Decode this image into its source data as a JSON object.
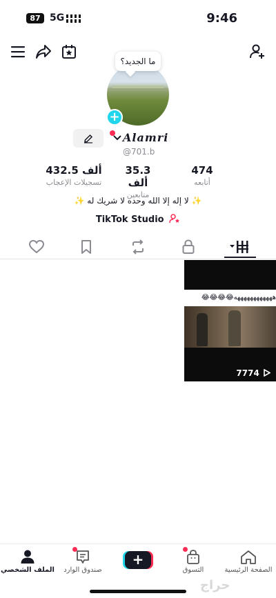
{
  "status_bar": {
    "battery": "87",
    "network": "5G",
    "time": "9:46"
  },
  "tooltip": {
    "text": "ما الجديد؟"
  },
  "profile": {
    "display_name": "Alamri",
    "handle": "@701.b",
    "bio": "✨ لا إله إلا الله وحده لا شريك له ✨",
    "studio_label": "TikTok Studio"
  },
  "stats": {
    "following": {
      "value": "474",
      "label": "أتابعه"
    },
    "followers": {
      "value": "35.3 ألف",
      "label": "متابعين"
    },
    "likes": {
      "value": "432.5 ألف",
      "label": "تسجيلات الإعجاب"
    }
  },
  "tabs": [
    "videos",
    "private",
    "reposts",
    "favorites",
    "liked"
  ],
  "video": {
    "caption": "ههههههههههههه😂😂😂😂",
    "views": "7774"
  },
  "bottom_nav": {
    "home": "الصفحة الرئيسية",
    "shop": "التسوق",
    "inbox": "صندوق الوارد",
    "profile": "الملف الشخصي"
  },
  "watermark": "حراج",
  "colors": {
    "accent_red": "#fe2c55",
    "accent_cyan": "#20d5ec",
    "text": "#161823"
  }
}
